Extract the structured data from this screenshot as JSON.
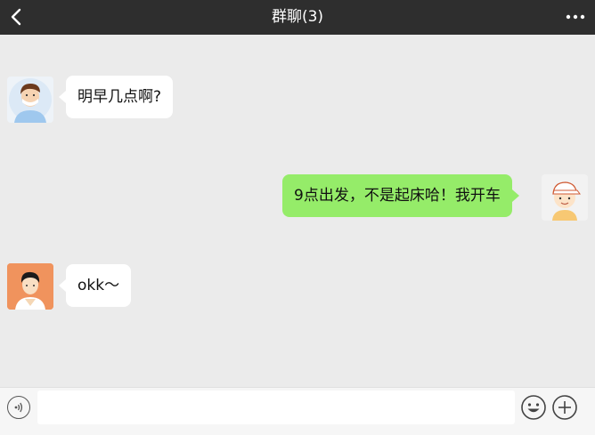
{
  "header": {
    "title": "群聊(3)",
    "back_icon": "chevron-left-icon",
    "more_icon": "more-dots-icon"
  },
  "messages": [
    {
      "side": "left",
      "avatar": "avatar-masked-man",
      "text": "明早几点啊?"
    },
    {
      "side": "right",
      "avatar": "avatar-cap-boy",
      "text": "9点出发，不是起床哈！我开车"
    },
    {
      "side": "left",
      "avatar": "avatar-orange-man",
      "text": "okk～"
    }
  ],
  "input_bar": {
    "voice_icon": "voice-icon",
    "text_value": "",
    "emoji_icon": "emoji-icon",
    "plus_icon": "plus-icon"
  },
  "colors": {
    "header_bg": "#2e2e2e",
    "chat_bg": "#ebebeb",
    "bubble_left": "#ffffff",
    "bubble_right": "#95ec69",
    "input_bar_bg": "#f6f6f6"
  }
}
